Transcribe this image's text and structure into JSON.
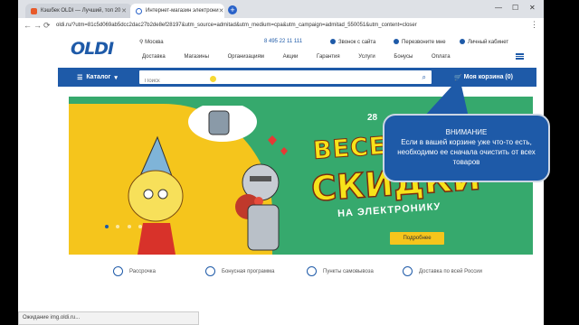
{
  "browser": {
    "tabs": [
      {
        "label": "Кэшбек OLDI — Лучший, топ 20"
      },
      {
        "label": "Интернет-магазин электрони"
      }
    ],
    "new_tab": "+",
    "window_controls": {
      "minimize": "—",
      "maximize": "☐",
      "close": "✕"
    },
    "url": "oldi.ru/?utm=81c5d069ab5dcc2dac27b2de8ef28197&utm_source=admitad&utm_medium=cpa&utm_campaign=admitad_550051&utm_content=closer",
    "status": "Ожидание img.oldi.ru..."
  },
  "site": {
    "logo": "OLDI",
    "city": "Москва",
    "phone": "8 495 22 11 111",
    "header_links": [
      "Звонок с сайта",
      "Перезвоните мне",
      "Личный кабинет"
    ],
    "nav": [
      "Доставка",
      "Магазины",
      "Организациям",
      "Акции",
      "Гарантия",
      "Услуги",
      "Бонусы",
      "Оплата"
    ],
    "catalog_label": "Каталог",
    "search_placeholder": "Поиск",
    "cart_label": "Моя корзина (0)"
  },
  "banner": {
    "date": "28",
    "headline_1": "ВЕСЕ",
    "headline_2": "СКИДКИ",
    "subline": "НА ЭЛЕКТРОНИКУ",
    "button": "Подробнее"
  },
  "features": [
    "Рассрочка",
    "Бонусная программа",
    "Пункты самовывоза",
    "Доставка по всей России"
  ],
  "callout": {
    "title": "ВНИМАНИЕ",
    "body": "Если в вашей корзине уже что-то есть, необходимо ее сначала очистить от всех товаров"
  },
  "colors": {
    "brand": "#1e5aa8",
    "banner_green": "#36a96d",
    "banner_yellow": "#f5c51c"
  }
}
